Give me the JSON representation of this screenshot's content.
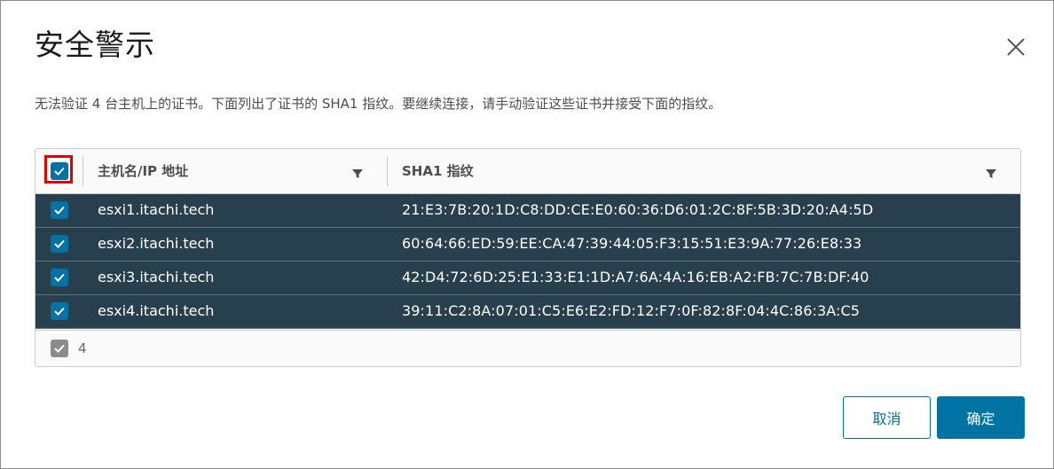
{
  "dialog": {
    "title": "安全警示",
    "description": "无法验证 4 台主机上的证书。下面列出了证书的 SHA1 指纹。要继续连接，请手动验证这些证书并接受下面的指纹。"
  },
  "grid": {
    "columns": {
      "host": "主机名/IP 地址",
      "sha": "SHA1 指纹"
    },
    "select_all_checked": true,
    "rows": [
      {
        "host": "esxi1.itachi.tech",
        "sha": "21:E3:7B:20:1D:C8:DD:CE:E0:60:36:D6:01:2C:8F:5B:3D:20:A4:5D",
        "checked": true
      },
      {
        "host": "esxi2.itachi.tech",
        "sha": "60:64:66:ED:59:EE:CA:47:39:44:05:F3:15:51:E3:9A:77:26:E8:33",
        "checked": true
      },
      {
        "host": "esxi3.itachi.tech",
        "sha": "42:D4:72:6D:25:E1:33:E1:1D:A7:6A:4A:16:EB:A2:FB:7C:7B:DF:40",
        "checked": true
      },
      {
        "host": "esxi4.itachi.tech",
        "sha": "39:11:C2:8A:07:01:C5:E6:E2:FD:12:F7:0F:82:8F:04:4C:86:3A:C5",
        "checked": true
      }
    ],
    "footer": {
      "selected_count": "4"
    }
  },
  "buttons": {
    "cancel": "取消",
    "ok": "确定"
  },
  "icons": {
    "close": "close-icon",
    "filter": "filter-icon",
    "check": "check-icon"
  },
  "colors": {
    "accent": "#0072a3",
    "selected_row": "#28404d",
    "highlight": "#e30000"
  }
}
